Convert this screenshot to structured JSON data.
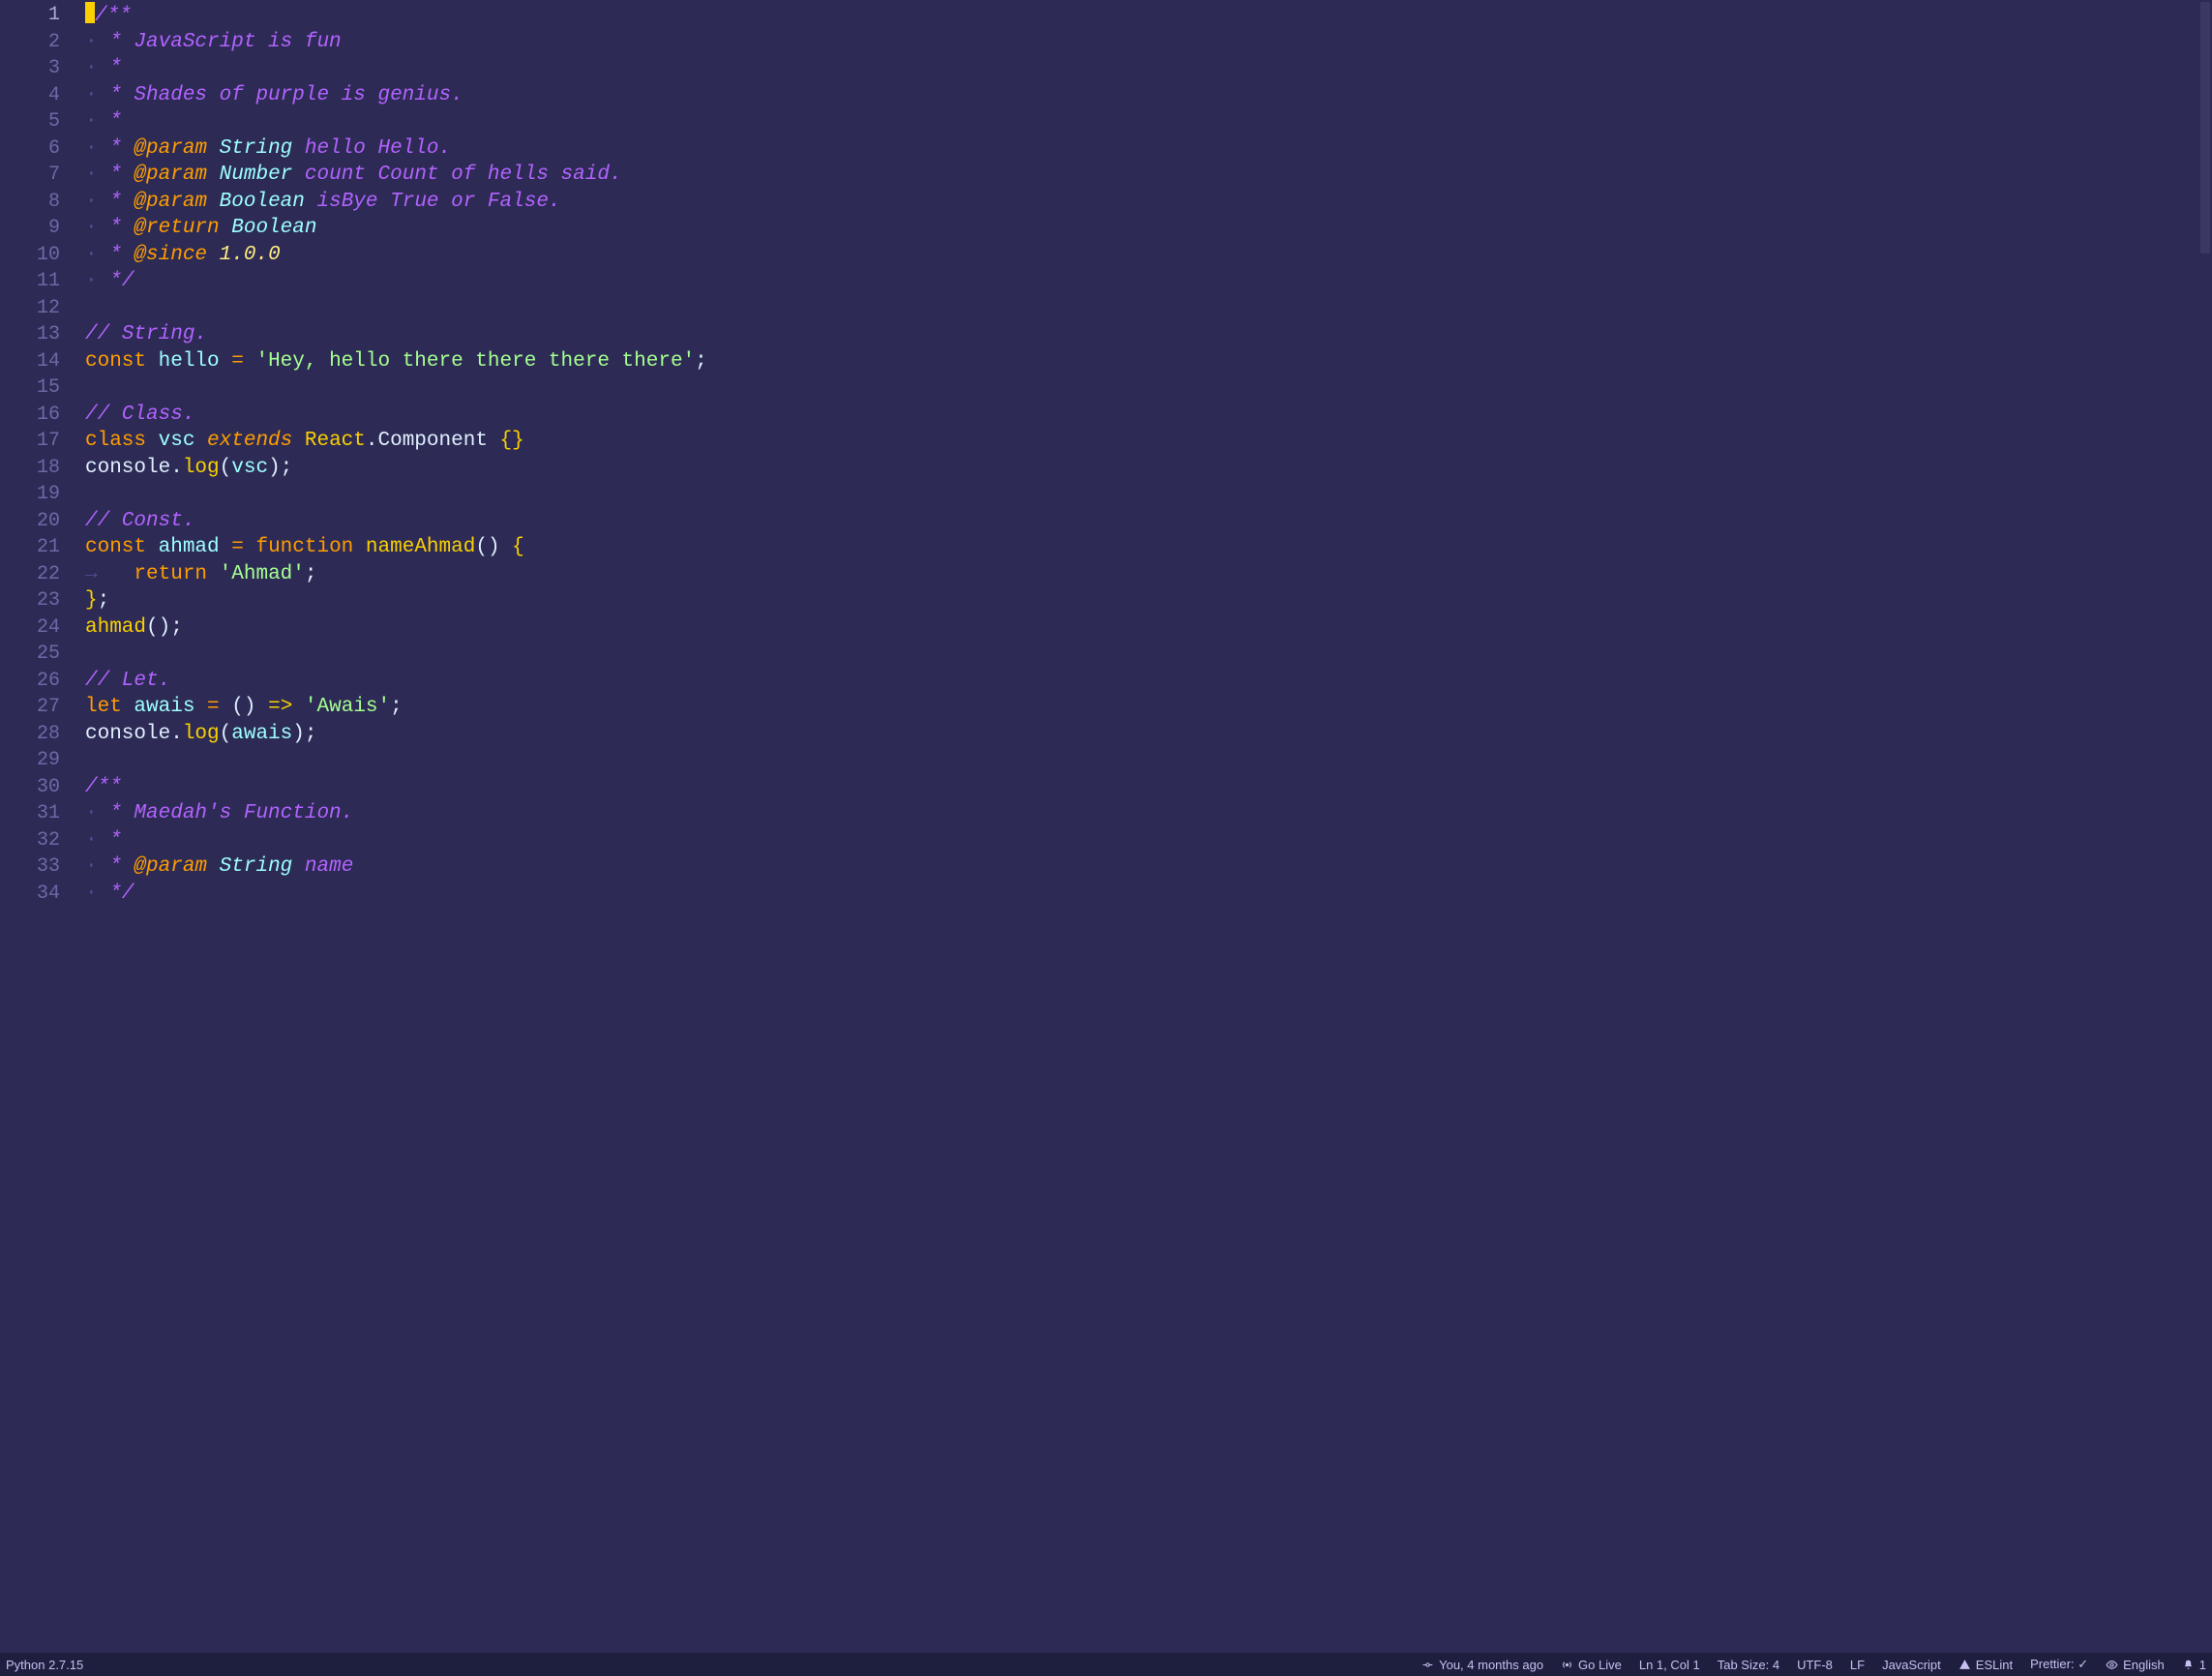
{
  "editor": {
    "gutter": {
      "lines": [
        "1",
        "2",
        "3",
        "4",
        "5",
        "6",
        "7",
        "8",
        "9",
        "10",
        "11",
        "12",
        "13",
        "14",
        "15",
        "16",
        "17",
        "18",
        "19",
        "20",
        "21",
        "22",
        "23",
        "24",
        "25",
        "26",
        "27",
        "28",
        "29",
        "30",
        "31",
        "32",
        "33",
        "34"
      ],
      "current_line_index": 0
    },
    "code": {
      "l1": {
        "open": "/**"
      },
      "l2": {
        "star": " * ",
        "text": "JavaScript is fun"
      },
      "l3": {
        "star": " *"
      },
      "l4": {
        "star": " * ",
        "text": "Shades of purple is genius."
      },
      "l5": {
        "star": " *"
      },
      "l6": {
        "star": " * ",
        "tag": "@param",
        "sp": " ",
        "type": "String",
        "sp2": " ",
        "var": "hello",
        "sp3": " ",
        "desc": "Hello."
      },
      "l7": {
        "star": " * ",
        "tag": "@param",
        "sp": " ",
        "type": "Number",
        "sp2": " ",
        "var": "count",
        "sp3": " ",
        "desc": "Count of hells said."
      },
      "l8": {
        "star": " * ",
        "tag": "@param",
        "sp": " ",
        "type": "Boolean",
        "sp2": " ",
        "var": "isBye",
        "sp3": " ",
        "desc": "True or False."
      },
      "l9": {
        "star": " * ",
        "tag": "@return",
        "sp": " ",
        "type": "Boolean"
      },
      "l10": {
        "star": " * ",
        "tag": "@since",
        "sp": " ",
        "ver": "1.0.0"
      },
      "l11": {
        "close": " */"
      },
      "l12": {
        "blank": ""
      },
      "l13": {
        "cm": "// String."
      },
      "l14": {
        "kw": "const",
        "sp": " ",
        "name": "hello",
        "sp2": " ",
        "eq": "=",
        "sp3": " ",
        "str": "'Hey, hello there there there there'",
        "semi": ";"
      },
      "l15": {
        "blank": ""
      },
      "l16": {
        "cm": "// Class."
      },
      "l17": {
        "kw": "class",
        "sp": " ",
        "name": "vsc",
        "sp2": " ",
        "ext": "extends",
        "sp3": " ",
        "obj": "React",
        "dot": ".",
        "prop": "Component",
        "sp4": " ",
        "br": "{}"
      },
      "l18": {
        "obj": "console",
        "dot": ".",
        "fn": "log",
        "po": "(",
        "arg": "vsc",
        "pc": ")",
        "semi": ";"
      },
      "l19": {
        "blank": ""
      },
      "l20": {
        "cm": "// Const."
      },
      "l21": {
        "kw": "const",
        "sp": " ",
        "name": "ahmad",
        "sp2": " ",
        "eq": "=",
        "sp3": " ",
        "fnkw": "function",
        "sp4": " ",
        "fname": "nameAhmad",
        "po": "(",
        "pc": ")",
        "sp5": " ",
        "br": "{"
      },
      "l22": {
        "indent": "   ",
        "ret": "return",
        "sp": " ",
        "str": "'Ahmad'",
        "semi": ";"
      },
      "l23": {
        "br": "}",
        "semi": ";"
      },
      "l24": {
        "fname": "ahmad",
        "po": "(",
        "pc": ")",
        "semi": ";"
      },
      "l25": {
        "blank": ""
      },
      "l26": {
        "cm": "// Let."
      },
      "l27": {
        "kw": "let",
        "sp": " ",
        "name": "awais",
        "sp2": " ",
        "eq": "=",
        "sp3": " ",
        "po": "(",
        "pc": ")",
        "sp4": " ",
        "arrow": "=>",
        "sp5": " ",
        "str": "'Awais'",
        "semi": ";"
      },
      "l28": {
        "obj": "console",
        "dot": ".",
        "fn": "log",
        "po": "(",
        "arg": "awais",
        "pc": ")",
        "semi": ";"
      },
      "l29": {
        "blank": ""
      },
      "l30": {
        "open": "/**"
      },
      "l31": {
        "star": " * ",
        "text": "Maedah's Function."
      },
      "l32": {
        "star": " *"
      },
      "l33": {
        "star": " * ",
        "tag": "@param",
        "sp": " ",
        "type": "String",
        "sp2": " ",
        "var": "name"
      },
      "l34": {
        "close": " */"
      },
      "whitespace_dot": "·",
      "tab_arrow": "→"
    }
  },
  "statusbar": {
    "left": {
      "python": "Python 2.7.15"
    },
    "right": {
      "git_blame": "You, 4 months ago",
      "go_live": "Go Live",
      "cursor": "Ln 1, Col 1",
      "indent": "Tab Size: 4",
      "encoding": "UTF-8",
      "eol": "LF",
      "language": "JavaScript",
      "eslint": "ESLint",
      "prettier": "Prettier: ✓",
      "spell": "English",
      "notifications": "1"
    }
  }
}
